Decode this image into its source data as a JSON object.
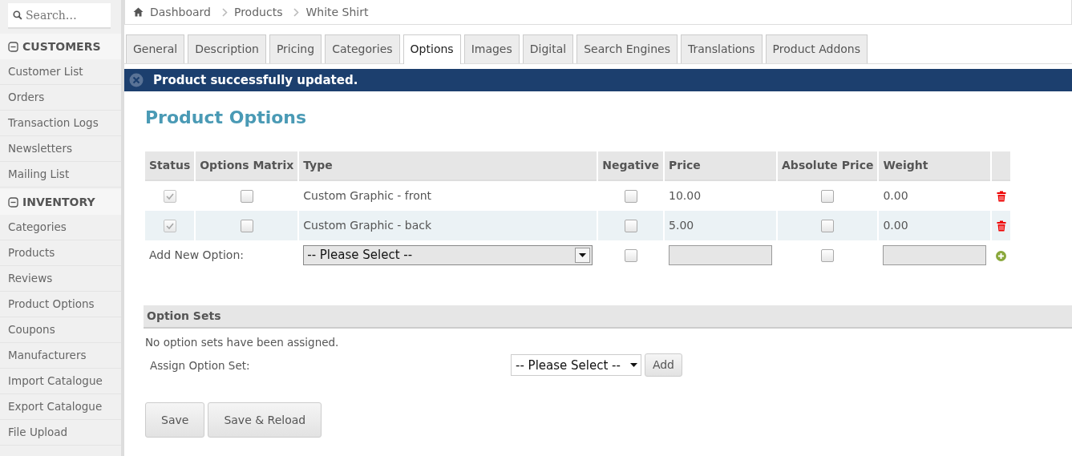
{
  "sidebar": {
    "search": {
      "placeholder": "Search…"
    },
    "sections": [
      {
        "title": "CUSTOMERS",
        "expanded": true,
        "items": [
          "Customer List",
          "Orders",
          "Transaction Logs",
          "Newsletters",
          "Mailing List"
        ]
      },
      {
        "title": "INVENTORY",
        "expanded": true,
        "items": [
          "Categories",
          "Products",
          "Reviews",
          "Product Options",
          "Coupons",
          "Manufacturers",
          "Import Catalogue",
          "Export Catalogue",
          "File Upload"
        ]
      }
    ]
  },
  "breadcrumb": [
    "Dashboard",
    "Products",
    "White Shirt"
  ],
  "tabs": [
    {
      "label": "General",
      "selected": false
    },
    {
      "label": "Description",
      "selected": false
    },
    {
      "label": "Pricing",
      "selected": false
    },
    {
      "label": "Categories",
      "selected": false
    },
    {
      "label": "Options",
      "selected": true
    },
    {
      "label": "Images",
      "selected": false
    },
    {
      "label": "Digital",
      "selected": false
    },
    {
      "label": "Search Engines",
      "selected": false
    },
    {
      "label": "Translations",
      "selected": false
    },
    {
      "label": "Product Addons",
      "selected": false
    }
  ],
  "alert": {
    "message": "Product successfully updated."
  },
  "heading": "Product Options",
  "options_table": {
    "columns": [
      "Status",
      "Options Matrix",
      "Type",
      "Negative",
      "Price",
      "Absolute Price",
      "Weight"
    ],
    "rows": [
      {
        "status": {
          "checked": true,
          "disabled": true
        },
        "matrix": false,
        "type": "Custom Graphic - front",
        "negative": false,
        "price": "10.00",
        "absolute": false,
        "weight": "0.00"
      },
      {
        "status": {
          "checked": true,
          "disabled": true
        },
        "matrix": false,
        "type": "Custom Graphic - back",
        "negative": false,
        "price": "5.00",
        "absolute": false,
        "weight": "0.00"
      }
    ],
    "add_row": {
      "label": "Add New Option:",
      "select": "-- Please Select --",
      "negative": false,
      "absolute": false
    }
  },
  "option_sets": {
    "title": "Option Sets",
    "empty_message": "No option sets have been assigned.",
    "assign_label": "Assign Option Set:",
    "select": "-- Please Select --",
    "add_button": "Add"
  },
  "buttons": [
    "Save",
    "Save & Reload"
  ]
}
